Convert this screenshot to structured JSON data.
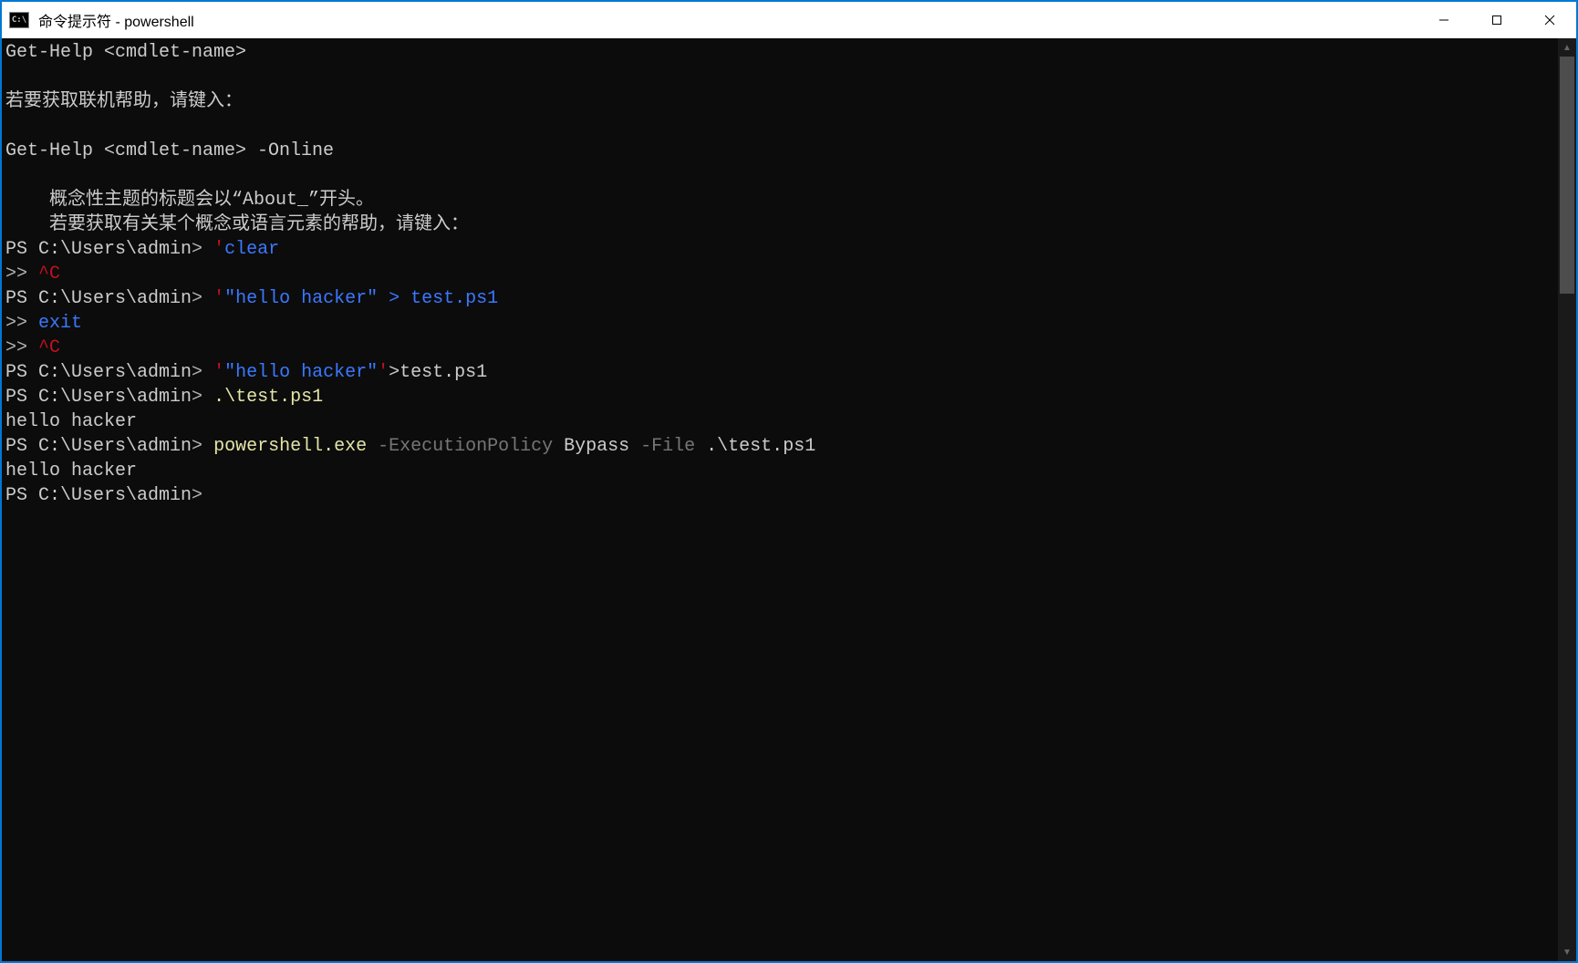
{
  "titlebar": {
    "icon_glyph": "C:\\",
    "title": "命令提示符 - powershell"
  },
  "terminal": {
    "lines": [
      {
        "segments": [
          {
            "cls": "c-white",
            "text": "Get-Help <cmdlet-name>"
          }
        ]
      },
      {
        "segments": [
          {
            "cls": "c-white",
            "text": ""
          }
        ]
      },
      {
        "segments": [
          {
            "cls": "c-white",
            "text": "若要获取联机帮助，请键入："
          }
        ]
      },
      {
        "segments": [
          {
            "cls": "c-white",
            "text": ""
          }
        ]
      },
      {
        "segments": [
          {
            "cls": "c-white",
            "text": "Get-Help <cmdlet-name> -Online"
          }
        ]
      },
      {
        "segments": [
          {
            "cls": "c-white",
            "text": ""
          }
        ]
      },
      {
        "segments": [
          {
            "cls": "c-white",
            "text": "    概念性主题的标题会以“About_”开头。"
          }
        ]
      },
      {
        "segments": [
          {
            "cls": "c-white",
            "text": "    若要获取有关某个概念或语言元素的帮助，请键入："
          }
        ]
      },
      {
        "segments": [
          {
            "cls": "c-prompt",
            "text": "PS C:\\Users\\admin"
          },
          {
            "cls": "c-gt",
            "text": "> "
          },
          {
            "cls": "c-red",
            "text": "'"
          },
          {
            "cls": "c-blue",
            "text": "clear"
          }
        ]
      },
      {
        "segments": [
          {
            "cls": "c-gt",
            "text": ">> "
          },
          {
            "cls": "c-red",
            "text": "^C"
          }
        ]
      },
      {
        "segments": [
          {
            "cls": "c-prompt",
            "text": "PS C:\\Users\\admin"
          },
          {
            "cls": "c-gt",
            "text": "> "
          },
          {
            "cls": "c-red",
            "text": "'"
          },
          {
            "cls": "c-blue",
            "text": "\"hello hacker\" > test.ps1"
          }
        ]
      },
      {
        "segments": [
          {
            "cls": "c-gt",
            "text": ">> "
          },
          {
            "cls": "c-blue",
            "text": "exit"
          }
        ]
      },
      {
        "segments": [
          {
            "cls": "c-gt",
            "text": ">> "
          },
          {
            "cls": "c-red",
            "text": "^C"
          }
        ]
      },
      {
        "segments": [
          {
            "cls": "c-prompt",
            "text": "PS C:\\Users\\admin"
          },
          {
            "cls": "c-gt",
            "text": "> "
          },
          {
            "cls": "c-red",
            "text": "'"
          },
          {
            "cls": "c-blue",
            "text": "\"hello hacker\""
          },
          {
            "cls": "c-red",
            "text": "'"
          },
          {
            "cls": "c-white",
            "text": ">test.ps1"
          }
        ]
      },
      {
        "segments": [
          {
            "cls": "c-prompt",
            "text": "PS C:\\Users\\admin"
          },
          {
            "cls": "c-gt",
            "text": "> "
          },
          {
            "cls": "c-cmd",
            "text": ".\\test.ps1"
          }
        ]
      },
      {
        "segments": [
          {
            "cls": "c-white",
            "text": "hello hacker"
          }
        ]
      },
      {
        "segments": [
          {
            "cls": "c-prompt",
            "text": "PS C:\\Users\\admin"
          },
          {
            "cls": "c-gt",
            "text": "> "
          },
          {
            "cls": "c-cmd",
            "text": "powershell.exe"
          },
          {
            "cls": "c-white",
            "text": " "
          },
          {
            "cls": "c-gray",
            "text": "-ExecutionPolicy"
          },
          {
            "cls": "c-white",
            "text": " Bypass "
          },
          {
            "cls": "c-gray",
            "text": "-File"
          },
          {
            "cls": "c-white",
            "text": " .\\test.ps1"
          }
        ]
      },
      {
        "segments": [
          {
            "cls": "c-white",
            "text": "hello hacker"
          }
        ]
      },
      {
        "segments": [
          {
            "cls": "c-prompt",
            "text": "PS C:\\Users\\admin"
          },
          {
            "cls": "c-gt",
            "text": ">"
          }
        ]
      }
    ]
  }
}
